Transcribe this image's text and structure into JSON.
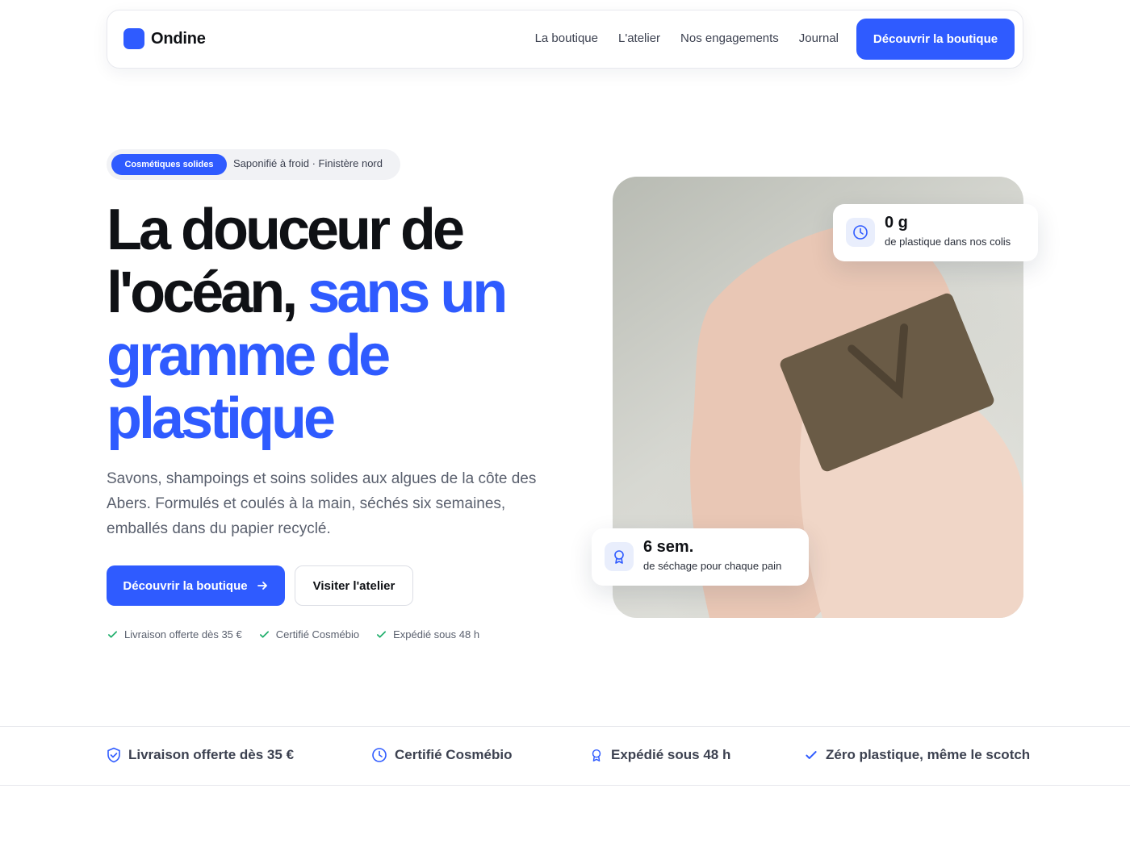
{
  "nav": {
    "brand": "Ondine",
    "links": [
      "La boutique",
      "L'atelier",
      "Nos engagements",
      "Journal"
    ],
    "cta": "Découvrir la boutique"
  },
  "hero": {
    "badge_pill": "Cosmétiques solides",
    "badge_text": "Saponifié à froid · Finistère nord",
    "headline_dark": "La douceur de l'océan,",
    "headline_blue": "sans un gramme de plastique",
    "lede": "Savons, shampoings et soins solides aux algues de la côte des Abers. Formulés et coulés à la main, séchés six semaines, emballés dans du papier recyclé.",
    "primary_cta": "Découvrir la boutique",
    "secondary_cta": "Visiter l'atelier",
    "checks": [
      "Livraison offerte dès 35 €",
      "Certifié Cosmébio",
      "Expédié sous 48 h"
    ]
  },
  "stats": [
    {
      "value": "0 g",
      "label": "de plastique dans nos colis",
      "icon": "clock-icon"
    },
    {
      "value": "6 sem.",
      "label": "de séchage pour chaque pain",
      "icon": "award-icon"
    }
  ],
  "strip": [
    {
      "label": "Livraison offerte dès 35 €",
      "icon": "shield-check-icon"
    },
    {
      "label": "Certifié Cosmébio",
      "icon": "clock-icon"
    },
    {
      "label": "Expédié sous 48 h",
      "icon": "award-icon"
    },
    {
      "label": "Zéro plastique, même le scotch",
      "icon": "check-icon"
    }
  ],
  "colors": {
    "accent": "#2f5bff",
    "text": "#0f1115",
    "muted": "#5a606e",
    "check": "#1fae6b"
  }
}
